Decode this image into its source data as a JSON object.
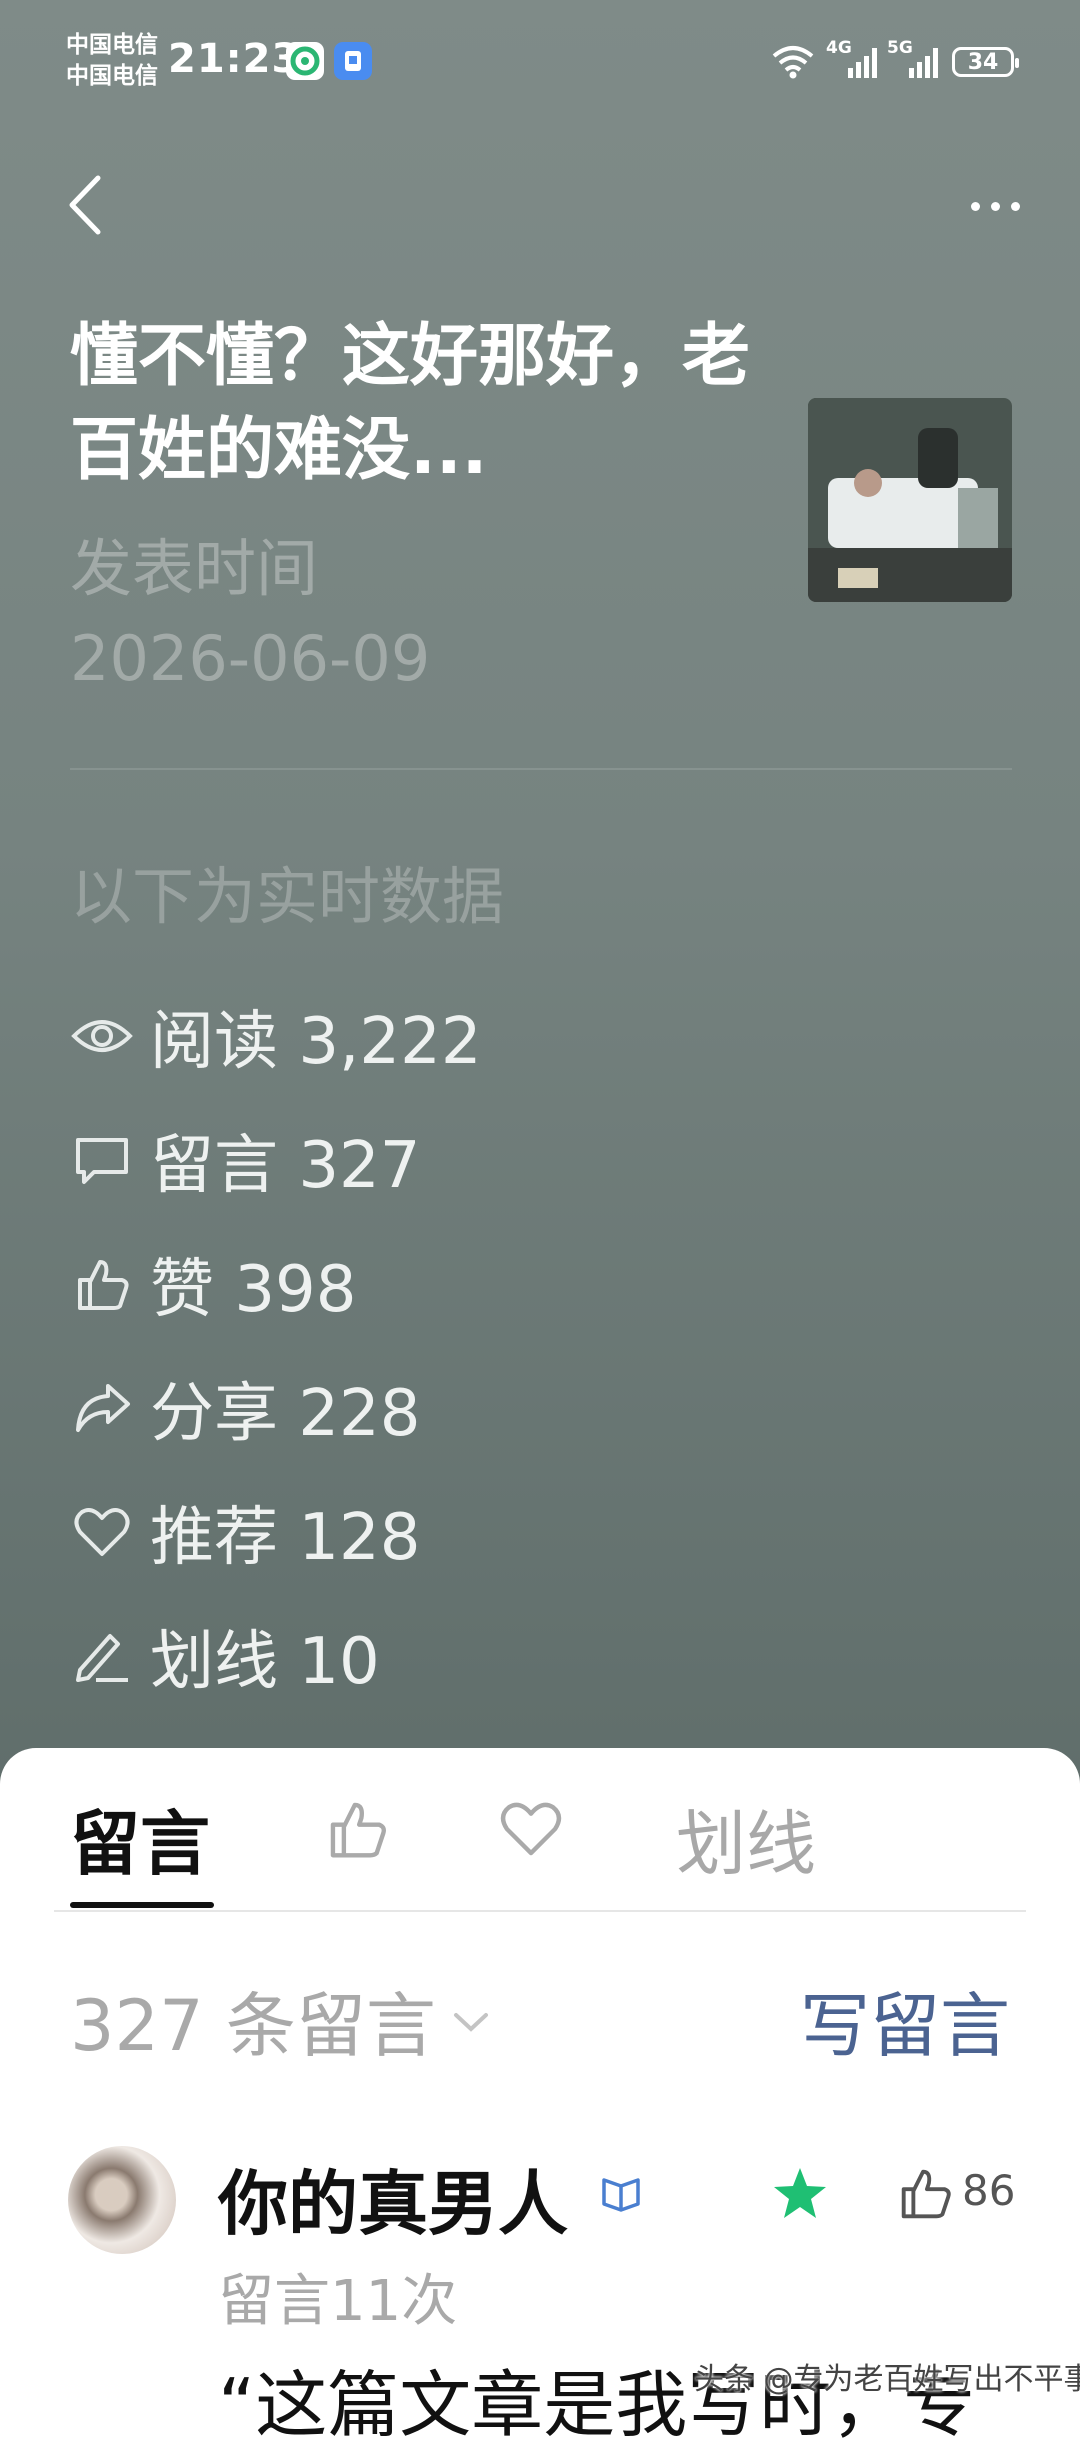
{
  "status": {
    "carrier1": "中国电信",
    "carrier2": "中国电信",
    "time": "21:23",
    "net1": "4G",
    "net2": "5G",
    "battery": "34"
  },
  "article": {
    "title": "懂不懂？这好那好，老百姓的难没...",
    "publish_label": "发表时间",
    "publish_date": "2026-06-09"
  },
  "realtime_label": "以下为实时数据",
  "stats": [
    {
      "icon": "eye-icon",
      "text": "阅读 3,222"
    },
    {
      "icon": "comment-icon",
      "text": "留言 327"
    },
    {
      "icon": "thumbs-up-icon",
      "text": "赞 398"
    },
    {
      "icon": "share-icon",
      "text": "分享 228"
    },
    {
      "icon": "heart-icon",
      "text": "推荐 128"
    },
    {
      "icon": "pen-icon",
      "text": "划线 10"
    }
  ],
  "tabs": {
    "comment": "留言",
    "underline": "划线"
  },
  "comments": {
    "count_label": "327 条留言",
    "write_label": "写留言",
    "first": {
      "user": "你的真男人",
      "times": "留言11次",
      "likes": "86",
      "snippet": "“这篇文章是我写时，专"
    }
  },
  "watermark": "头条 @专为老百姓写出不平事",
  "colors": {
    "accent_link": "#4b6391",
    "star": "#1fbf73",
    "background": "#76827f"
  }
}
